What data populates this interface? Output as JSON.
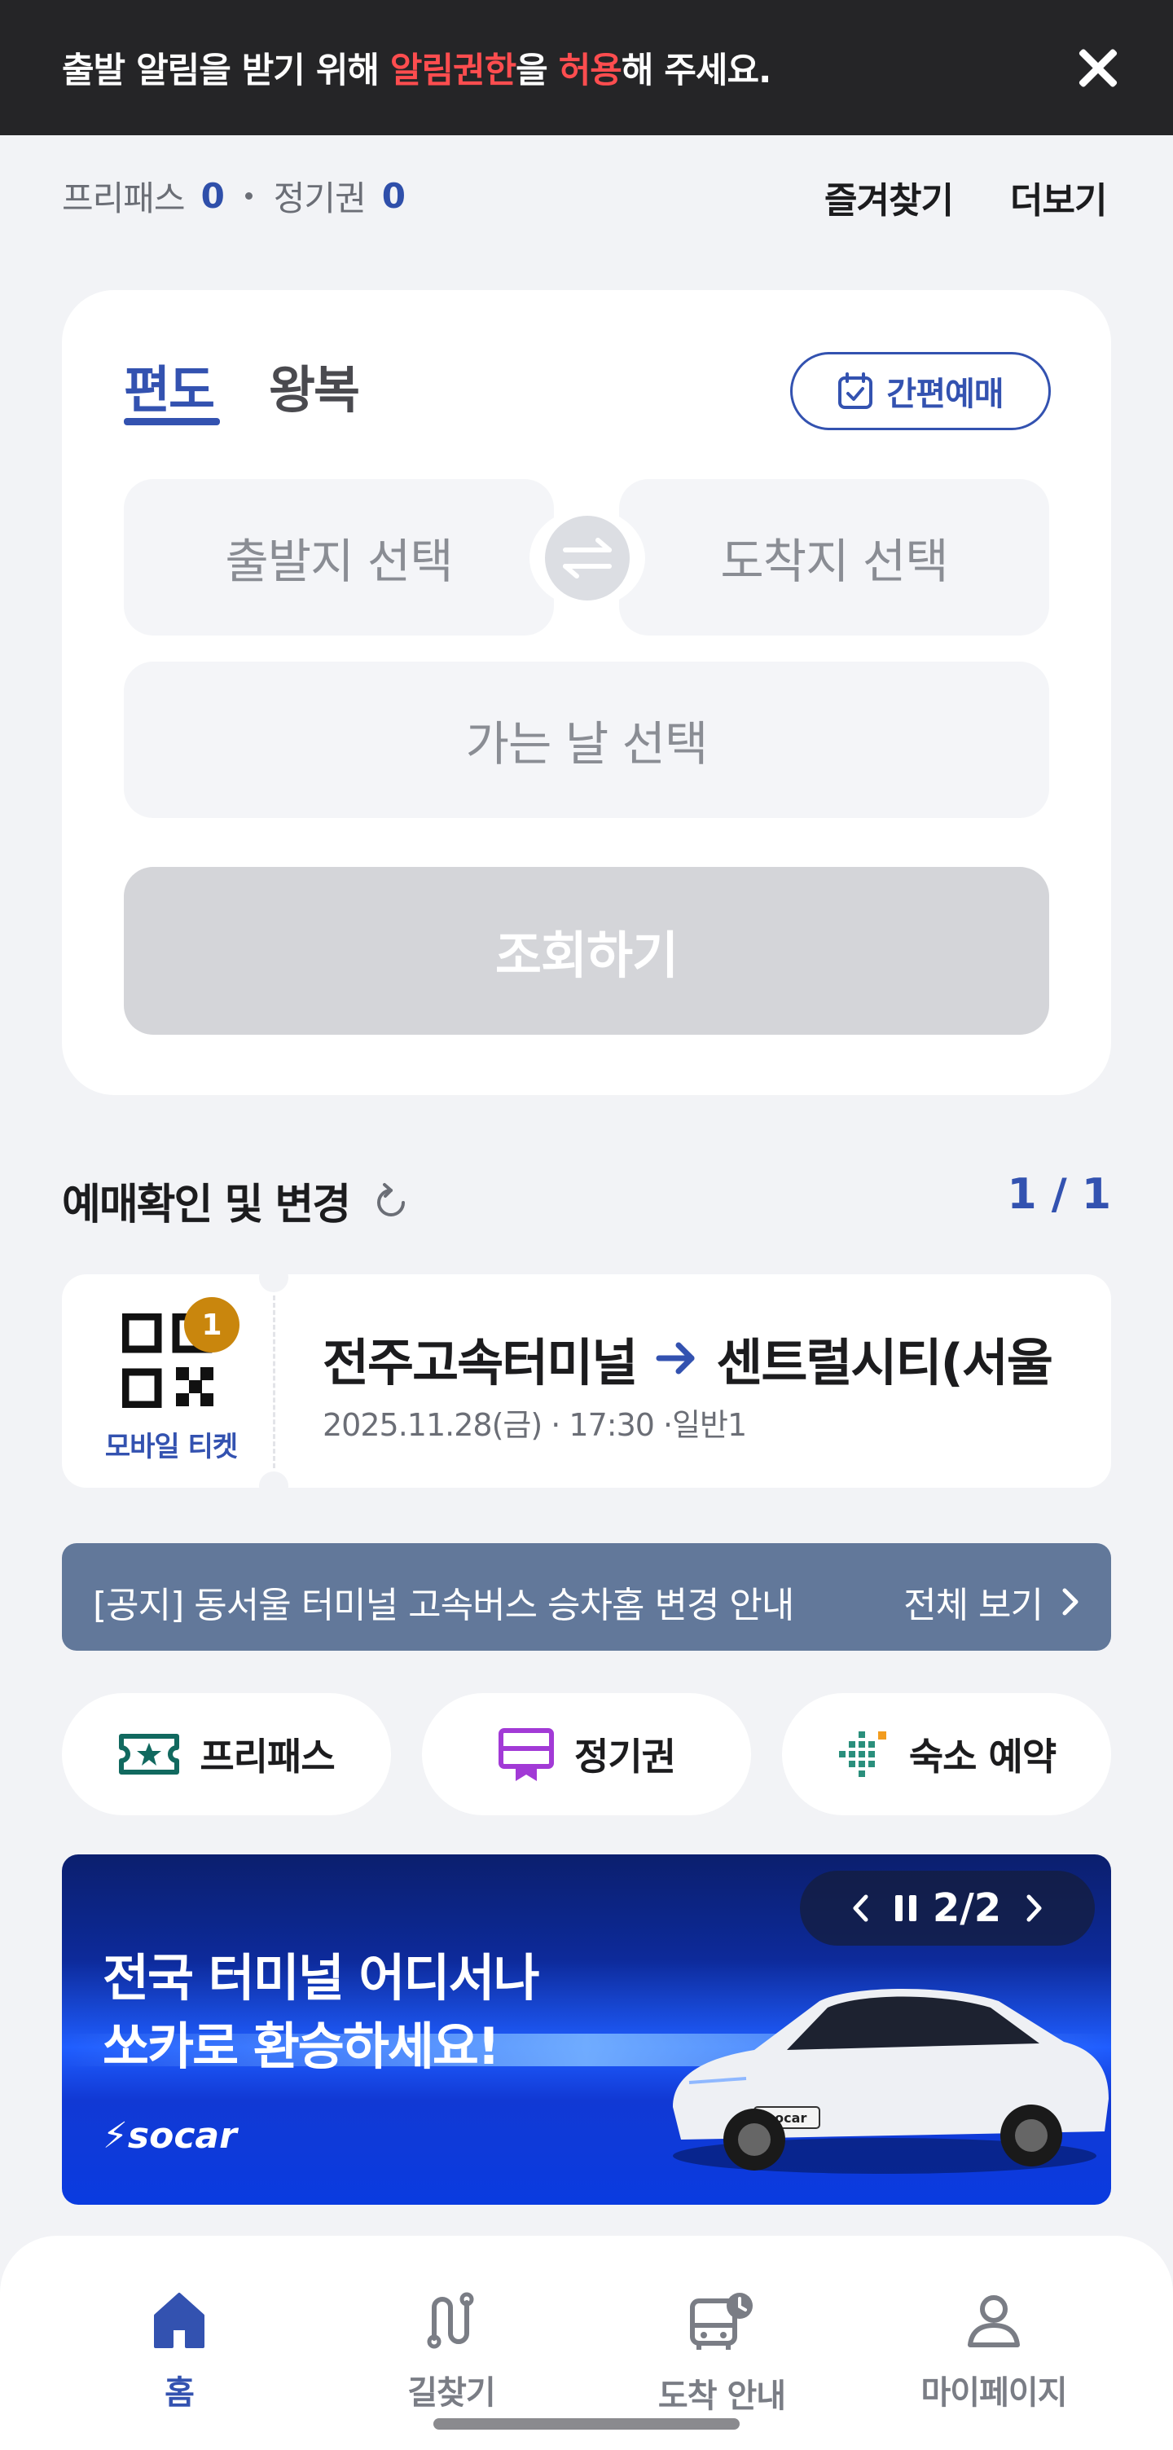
{
  "notification": {
    "text_a": "출발 알림을 받기 위해 ",
    "text_hl1": "알림권한",
    "text_b": "을 ",
    "text_hl2": "허용",
    "text_c": "해 주세요.",
    "close_icon": "close-icon"
  },
  "header": {
    "freepass_label": "프리패스",
    "freepass_count": "0",
    "season_label": "정기권",
    "season_count": "0",
    "favorites_label": "즐겨찾기",
    "more_label": "더보기"
  },
  "booking": {
    "tab_oneway": "편도",
    "tab_roundtrip": "왕복",
    "quick_booking": "간편예매",
    "departure_placeholder": "출발지 선택",
    "arrival_placeholder": "도착지 선택",
    "date_placeholder": "가는 날 선택",
    "search_button": "조회하기"
  },
  "reservation": {
    "title": "예매확인 및 변경",
    "page": "1 / 1",
    "badge": "1",
    "mobile_ticket": "모바일 티켓",
    "from": "전주고속터미널",
    "to": "센트럴시티(서울",
    "info": "2025.11.28(금) · 17:30 ·일반1"
  },
  "news": {
    "text": "[공지] 동서울 터미널 고속버스 승차홈 변경 안내",
    "view_all": "전체 보기"
  },
  "shortcuts": [
    {
      "label": "프리패스",
      "icon": "ticket-star-icon"
    },
    {
      "label": "정기권",
      "icon": "season-pass-icon"
    },
    {
      "label": "숙소 예약",
      "icon": "lodging-icon"
    }
  ],
  "banner": {
    "line1": "전국 터미널 어디서나",
    "line2": "쏘카로 환승하세요!",
    "logo": "socar",
    "car_plate": "socar",
    "counter": "2/2"
  },
  "bottom_nav": [
    {
      "label": "홈",
      "icon": "home-icon",
      "active": true
    },
    {
      "label": "길찾기",
      "icon": "route-icon",
      "active": false
    },
    {
      "label": "도착 안내",
      "icon": "bus-clock-icon",
      "active": false
    },
    {
      "label": "마이페이지",
      "icon": "person-icon",
      "active": false
    }
  ],
  "colors": {
    "accent": "#3352b0",
    "highlight": "#ff4d4f",
    "badge": "#c9860d",
    "news_bg": "#62789a"
  }
}
